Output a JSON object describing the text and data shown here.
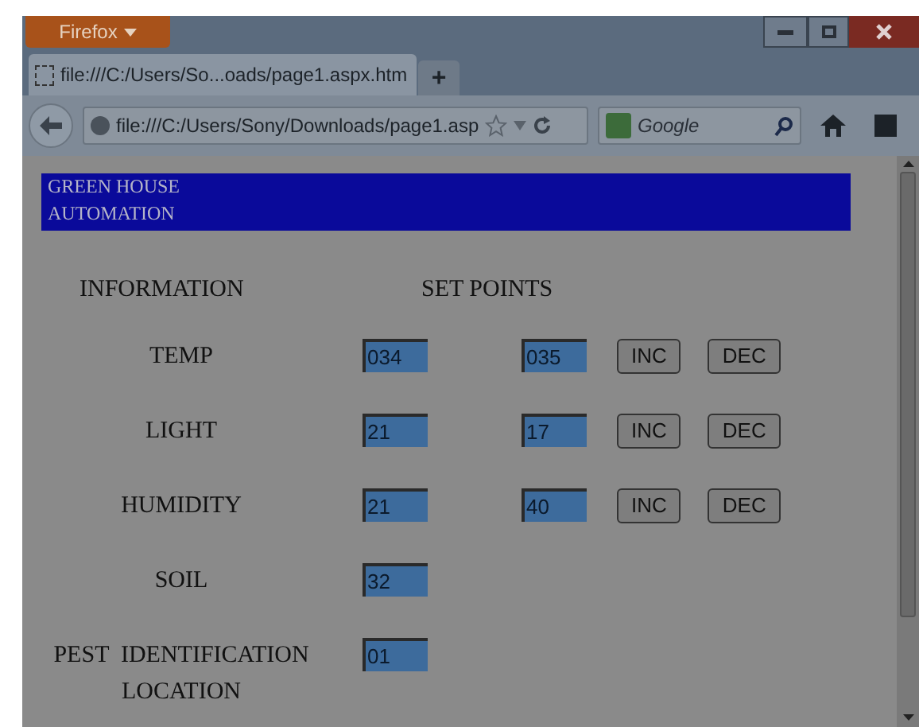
{
  "browser": {
    "menu_button": "Firefox",
    "tab_title": "file:///C:/Users/So...oads/page1.aspx.htm",
    "new_tab": "+",
    "url": "file:///C:/Users/Sony/Downloads/page1.asp",
    "search_placeholder": "Google"
  },
  "banner": [
    "GREEN HOUSE",
    "AUTOMATION"
  ],
  "headers": {
    "information": "INFORMATION",
    "set_points": "SET POINTS"
  },
  "rows": [
    {
      "kind": "setpoint",
      "label": [
        "TEMP"
      ],
      "value": "034",
      "setpoint": "035",
      "buttons": [
        "INC",
        "DEC"
      ]
    },
    {
      "kind": "setpoint",
      "label": [
        "LIGHT"
      ],
      "value": "21",
      "setpoint": "17",
      "buttons": [
        "INC",
        "DEC"
      ]
    },
    {
      "kind": "setpoint",
      "label": [
        "HUMIDITY"
      ],
      "value": "21",
      "setpoint": "40",
      "buttons": [
        "INC",
        "DEC"
      ]
    },
    {
      "kind": "reading",
      "label": [
        "SOIL"
      ],
      "value": "32"
    },
    {
      "kind": "reading",
      "label": [
        "PEST  IDENTIFICATION",
        "LOCATION"
      ],
      "value": "01"
    }
  ]
}
